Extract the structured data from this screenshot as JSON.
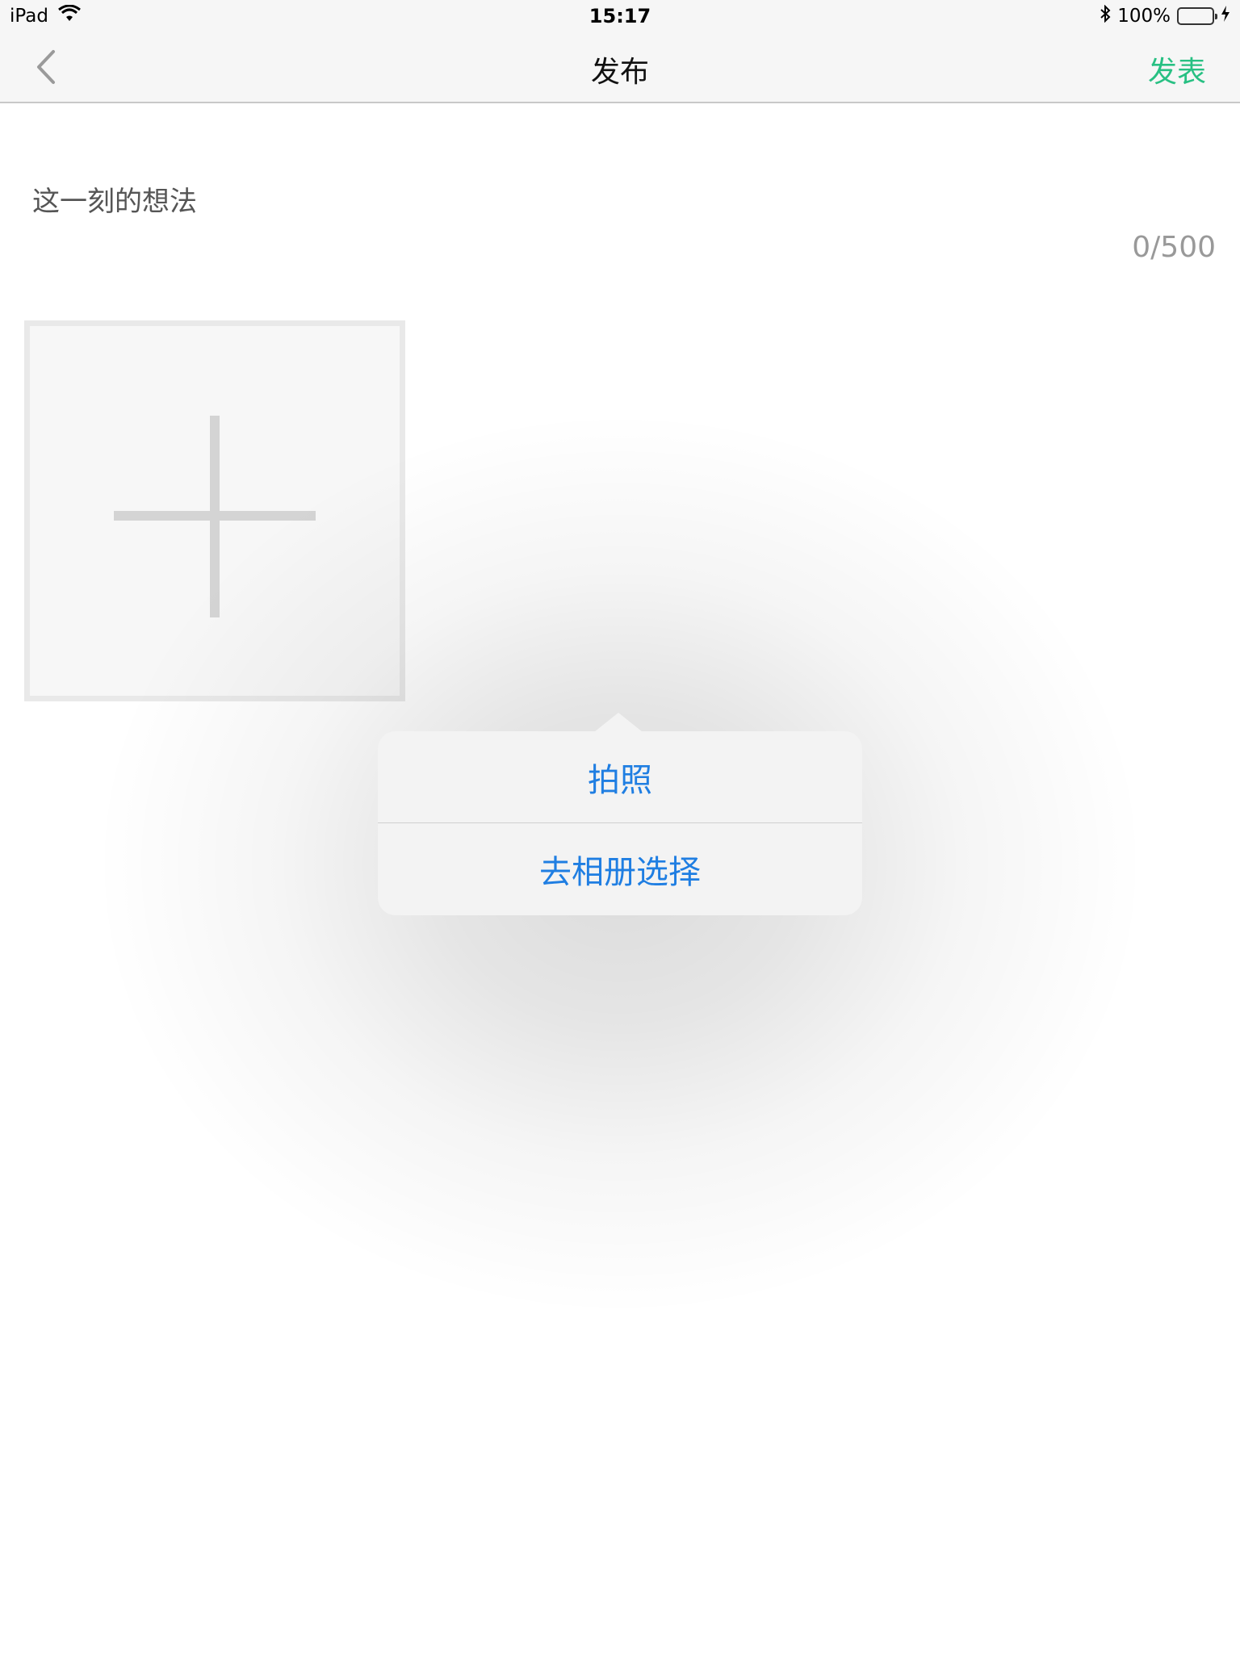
{
  "status_bar": {
    "device": "iPad",
    "time": "15:17",
    "battery_percent": "100%",
    "icons": [
      "wifi-icon",
      "bluetooth-icon",
      "battery-icon",
      "charging-icon"
    ],
    "battery_level": 1.0
  },
  "nav": {
    "back_icon": "chevron-left-icon",
    "title": "发布",
    "publish_label": "发表",
    "publish_color": "#28c083"
  },
  "composer": {
    "placeholder": "这一刻的想法",
    "counter": "0/500",
    "add_photo_icon": "plus-icon"
  },
  "popover": {
    "items": [
      {
        "label": "拍照"
      },
      {
        "label": "去相册选择"
      }
    ],
    "item_color": "#1f7ee2"
  }
}
